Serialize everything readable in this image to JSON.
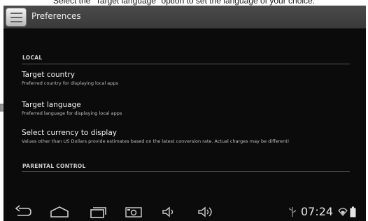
{
  "caption": "Select the \"Target language\" option to set the language of your choice.",
  "action_bar": {
    "title": "Preferences",
    "app_icon": "app-icon"
  },
  "sections": {
    "local": {
      "header": "LOCAL"
    },
    "parental": {
      "header": "PARENTAL CONTROL"
    }
  },
  "items": [
    {
      "title": "Target country",
      "summary": "Preferred country for displaying local apps"
    },
    {
      "title": "Target language",
      "summary": "Preferred language for displaying local apps"
    },
    {
      "title": "Select currency to display",
      "summary": "Values other than US Dollars provide estimates based on the latest conversion rate. Actual charges may be different!"
    }
  ],
  "nav_bar": {
    "buttons": [
      "back-icon",
      "home-icon",
      "recent-apps-icon",
      "screenshot-icon",
      "volume-down-icon",
      "volume-up-icon"
    ],
    "status": {
      "time": "07:24",
      "icons": [
        "usb-icon",
        "wifi-icon",
        "battery-icon"
      ]
    }
  },
  "colors": {
    "screen_bg": "#0b0b0b",
    "action_bar": "#444444",
    "text_primary": "#f2f2f2",
    "text_secondary": "#bdbdbd",
    "divider": "#555555"
  }
}
